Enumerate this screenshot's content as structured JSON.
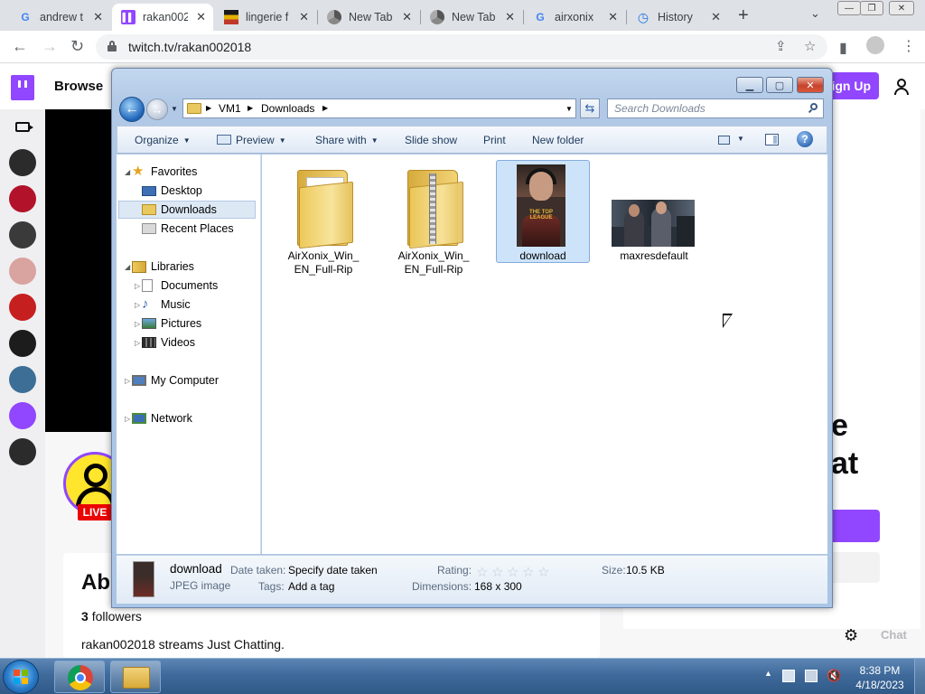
{
  "browser": {
    "tabs": [
      {
        "title": "andrew t",
        "favicon": "google-g",
        "active": false
      },
      {
        "title": "rakan002",
        "favicon": "twitch",
        "active": true
      },
      {
        "title": "lingerie f",
        "favicon": "striped-flag",
        "active": false
      },
      {
        "title": "New Tab",
        "favicon": "chrome",
        "active": false
      },
      {
        "title": "New Tab",
        "favicon": "chrome",
        "active": false
      },
      {
        "title": "airxonix",
        "favicon": "google-g",
        "active": false
      },
      {
        "title": "History",
        "favicon": "history-clock",
        "active": false
      }
    ],
    "url": "twitch.tv/rakan002018"
  },
  "twitch": {
    "browse_label": "Browse",
    "signup_label": "Sign Up",
    "live_badge": "LIVE",
    "about_heading": "Ab",
    "followers_count": "3",
    "followers_label": "followers",
    "description": "rakan002018 streams Just Chatting.",
    "chat_heading_line1": "e",
    "chat_heading_line2": "at",
    "chat_send_label": "Chat",
    "channel_avatar_colors": [
      "#2b2b2b",
      "#b2132a",
      "#3a3a3a",
      "#d9a3a0",
      "#c61f1f",
      "#1c1c1c",
      "#3d6f96",
      "#9146ff",
      "#2b2b2b"
    ],
    "accent_color": "#9146ff"
  },
  "explorer": {
    "breadcrumb": [
      "VM1",
      "Downloads"
    ],
    "search_placeholder": "Search Downloads",
    "commands": {
      "organize": "Organize",
      "preview": "Preview",
      "share_with": "Share with",
      "slide_show": "Slide show",
      "print": "Print",
      "new_folder": "New folder"
    },
    "nav": {
      "favorites": "Favorites",
      "desktop": "Desktop",
      "downloads": "Downloads",
      "recent_places": "Recent Places",
      "libraries": "Libraries",
      "documents": "Documents",
      "music": "Music",
      "pictures": "Pictures",
      "videos": "Videos",
      "my_computer": "My Computer",
      "network": "Network"
    },
    "files": [
      {
        "name": "AirXonix_Win_EN_Full-Rip",
        "type": "folder"
      },
      {
        "name": "AirXonix_Win_EN_Full-Rip",
        "type": "zip"
      },
      {
        "name": "download",
        "type": "image",
        "selected": true
      },
      {
        "name": "maxresdefault",
        "type": "image"
      }
    ],
    "thumbnail_caption": "THE TOP LEAGUE",
    "details": {
      "name": "download",
      "file_type": "JPEG image",
      "date_taken_label": "Date taken:",
      "date_taken_value": "Specify date taken",
      "tags_label": "Tags:",
      "tags_value": "Add a tag",
      "rating_label": "Rating:",
      "rating_stars": 0,
      "dimensions_label": "Dimensions:",
      "dimensions_value": "168 x 300",
      "size_label": "Size:",
      "size_value": "10.5 KB"
    }
  },
  "taskbar": {
    "time": "8:38 PM",
    "date": "4/18/2023"
  }
}
